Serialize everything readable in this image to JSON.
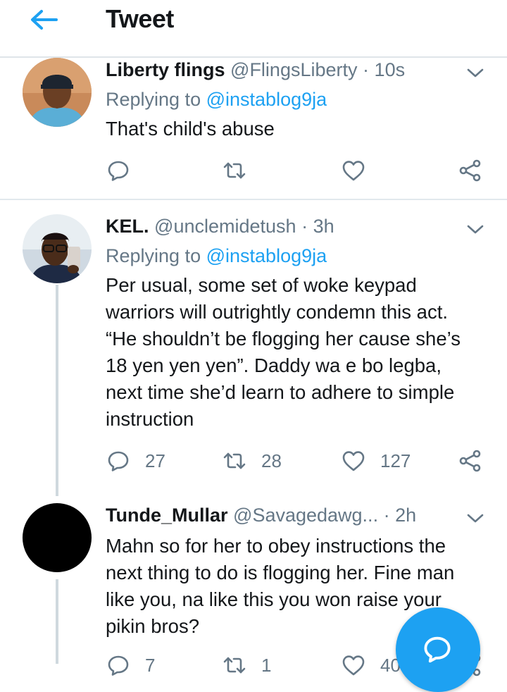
{
  "header": {
    "title": "Tweet",
    "back_icon": "arrow-left-icon"
  },
  "colors": {
    "accent": "#1da1f2",
    "muted": "#657786",
    "text": "#14171a"
  },
  "tweets": [
    {
      "name": "Liberty flings",
      "handle": "@FlingsLiberty",
      "time": "10s",
      "replying_prefix": "Replying to",
      "replying_to": "@instablog9ja",
      "text": "That's child's abuse",
      "actions": {
        "reply": "",
        "retweet": "",
        "like": ""
      }
    },
    {
      "name": "KEL.",
      "handle": "@unclemidetush",
      "time": "3h",
      "replying_prefix": "Replying to",
      "replying_to": "@instablog9ja",
      "text_lines": [
        "Per usual, some set of woke keypad",
        "warriors will outrightly condemn this act.",
        "“He shouldn’t be flogging her cause she’s",
        "18 yen yen yen”. Daddy wa e bo legba,",
        "next time she’d learn to adhere to simple",
        "instruction"
      ],
      "actions": {
        "reply": "27",
        "retweet": "28",
        "like": "127"
      }
    },
    {
      "name": "Tunde_Mullar",
      "handle": "@Savagedawg...",
      "time": "2h",
      "text_lines": [
        "Mahn so for her to obey instructions the",
        "next thing to do is flogging her. Fine man",
        "like you, na like this you won raise your",
        "pikin bros?"
      ],
      "actions": {
        "reply": "7",
        "retweet": "1",
        "like": "40"
      }
    }
  ],
  "fab": {
    "icon": "compose-reply-icon"
  }
}
